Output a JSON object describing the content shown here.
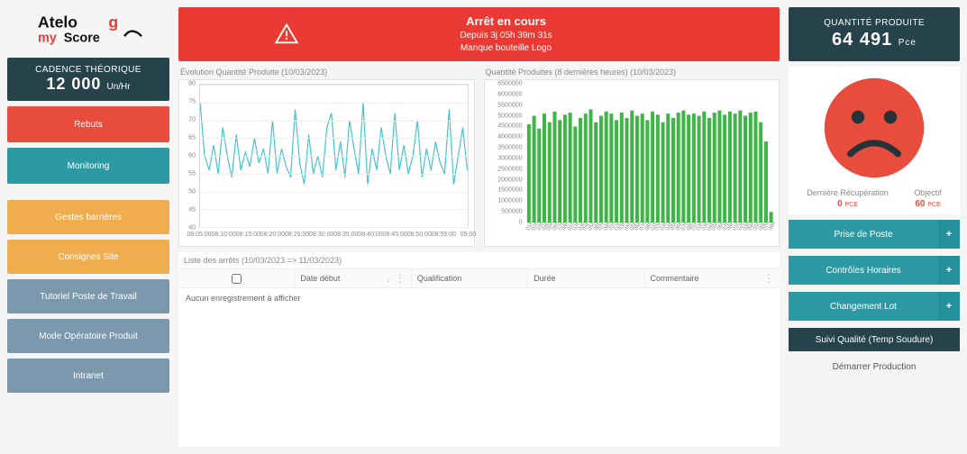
{
  "logo": {
    "brand_top": "Atelo",
    "brand_bottom": "Score",
    "brand_prefix": "my",
    "accent_char": "g"
  },
  "left": {
    "cadence_label": "CADENCE THÉORIQUE",
    "cadence_value": "12 000",
    "cadence_unit": "Un/Hr",
    "btns": [
      {
        "label": "Rebuts",
        "cls": "red"
      },
      {
        "label": "Monitoring",
        "cls": "teal"
      },
      {
        "label": "Gestes barrières",
        "cls": "orange"
      },
      {
        "label": "Consignes Site",
        "cls": "orange"
      },
      {
        "label": "Tutoriel Poste de Travail",
        "cls": "steel"
      },
      {
        "label": "Mode Opératoire Produit",
        "cls": "steel"
      },
      {
        "label": "Intranet",
        "cls": "steel"
      }
    ]
  },
  "banner": {
    "title": "Arrêt en cours",
    "since": "Depuis 3j 05h 39m 31s",
    "reason": "Manque bouteille Logo"
  },
  "chart_data": [
    {
      "type": "line",
      "title": "Évolution Quantité Produite (10/03/2023)",
      "ylabel": "",
      "xlabel": "",
      "ylim": [
        40,
        80
      ],
      "yticks": [
        40,
        45,
        50,
        55,
        60,
        65,
        70,
        75,
        80
      ],
      "xticks": [
        "08:05:00",
        "08:10:00",
        "08:15:00",
        "08:20:00",
        "08:25:00",
        "08:30:00",
        "08:35:00",
        "08:40:00",
        "08:45:00",
        "08:50:00",
        "08:55:00",
        "09:00"
      ],
      "values": [
        75,
        60,
        56,
        63,
        55,
        68,
        60,
        54,
        66,
        56,
        61,
        57,
        65,
        58,
        62,
        55,
        70,
        55,
        62,
        57,
        54,
        73,
        58,
        52,
        66,
        55,
        60,
        54,
        68,
        72,
        56,
        64,
        54,
        70,
        62,
        55,
        75,
        52,
        62,
        56,
        68,
        60,
        55,
        72,
        56,
        63,
        55,
        60,
        70,
        54,
        62,
        56,
        64,
        58,
        55,
        73,
        52,
        60,
        68,
        56
      ]
    },
    {
      "type": "bar",
      "title": "Quantité Produites (8 dernières heures) (10/03/2023)",
      "ylabel": "",
      "xlabel": "",
      "ylim": [
        0,
        6500000
      ],
      "yticks": [
        0,
        500000,
        1000000,
        1500000,
        2000000,
        2500000,
        3000000,
        3500000,
        4000000,
        4500000,
        5000000,
        5500000,
        6000000,
        6500000
      ],
      "categories": [
        "01h",
        "02h",
        "03h",
        "04h",
        "05h",
        "06h",
        "07h",
        "08h",
        "01h",
        "02h",
        "03h",
        "04h",
        "05h",
        "06h",
        "07h",
        "08h",
        "01h",
        "02h",
        "03h",
        "04h",
        "05h",
        "06h",
        "07h",
        "08h",
        "01h",
        "02h",
        "03h",
        "04h",
        "05h",
        "06h",
        "07h",
        "08h",
        "01h",
        "02h",
        "03h",
        "04h",
        "05h",
        "06h",
        "07h",
        "08h",
        "01h",
        "02h",
        "03h",
        "04h",
        "05h",
        "06h",
        "07h",
        "08h"
      ],
      "values": [
        4600000,
        5000000,
        4400000,
        5100000,
        4700000,
        5200000,
        4800000,
        5050000,
        5150000,
        4500000,
        4900000,
        5100000,
        5300000,
        4700000,
        5000000,
        5200000,
        5100000,
        4800000,
        5150000,
        4900000,
        5250000,
        5000000,
        5100000,
        4800000,
        5200000,
        5050000,
        4700000,
        5100000,
        4900000,
        5150000,
        5250000,
        5050000,
        5100000,
        5000000,
        5200000,
        4900000,
        5150000,
        5250000,
        5050000,
        5200000,
        5100000,
        5250000,
        5000000,
        5150000,
        5200000,
        4700000,
        3800000,
        500000
      ]
    }
  ],
  "list": {
    "title": "Liste des arrêts (10/03/2023 => 11/03/2023)",
    "cols": {
      "a": "Date début",
      "b": "Qualification",
      "c": "Durée",
      "d": "Commentaire"
    },
    "empty": "Aucun enregistrement à afficher"
  },
  "right": {
    "qlabel": "QUANTITÉ PRODUITE",
    "qvalue": "64 491",
    "qunit": "Pce",
    "metric1_label": "Dernière Récupération",
    "metric1_value": "0",
    "metric1_unit": "PCE",
    "metric2_label": "Objectif",
    "metric2_value": "60",
    "metric2_unit": "PCE",
    "btns": [
      {
        "label": "Prise de Poste",
        "plus": true,
        "cls": ""
      },
      {
        "label": "Contrôles Horaires",
        "plus": true,
        "cls": ""
      },
      {
        "label": "Changement Lot",
        "plus": true,
        "cls": ""
      },
      {
        "label": "Suivi Qualité (Temp Soudure)",
        "plus": false,
        "cls": "dark"
      }
    ],
    "start_label": "Démarrer Production"
  }
}
